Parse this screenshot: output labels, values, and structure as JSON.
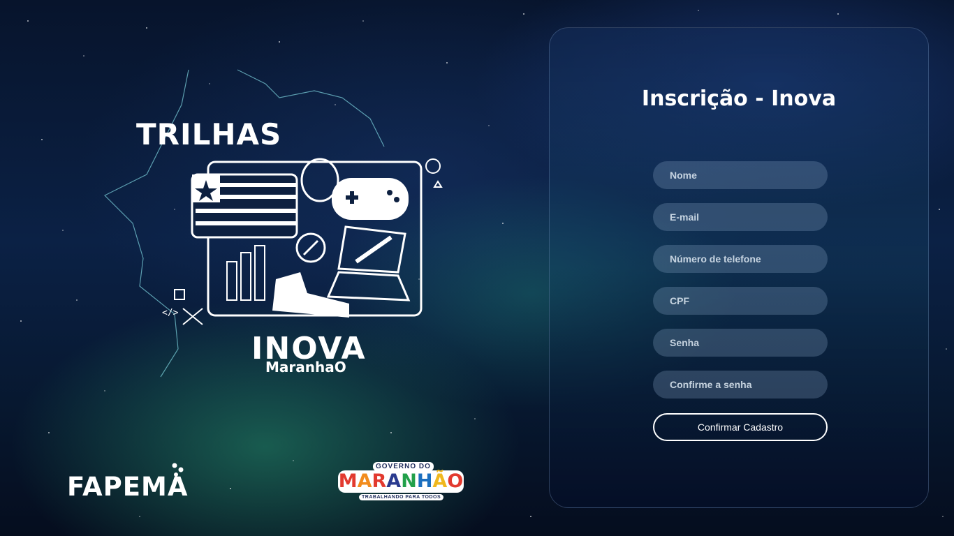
{
  "hero": {
    "title": "TRILHAS",
    "brand": "INOVA",
    "subbrand": "MaranhaO"
  },
  "logos": {
    "fapema": "FAPEMA",
    "gov_top": "GOVERNO DO",
    "gov_letters": [
      "M",
      "A",
      "R",
      "A",
      "N",
      "H",
      "Ã",
      "O"
    ],
    "gov_bottom": "TRABALHANDO PARA TODOS"
  },
  "form": {
    "title": "Inscrição - Inova",
    "fields": [
      {
        "placeholder": "Nome",
        "value": ""
      },
      {
        "placeholder": "E-mail",
        "value": ""
      },
      {
        "placeholder": "Número de telefone",
        "value": ""
      },
      {
        "placeholder": "CPF",
        "value": ""
      },
      {
        "placeholder": "Senha",
        "value": ""
      },
      {
        "placeholder": "Confirme a senha",
        "value": ""
      }
    ],
    "submit_label": "Confirmar Cadastro"
  },
  "colors": {
    "background": "#0b2145",
    "aurora": "#2a9670",
    "panel_border": "#7896be",
    "field_bg": "#8caac8"
  }
}
